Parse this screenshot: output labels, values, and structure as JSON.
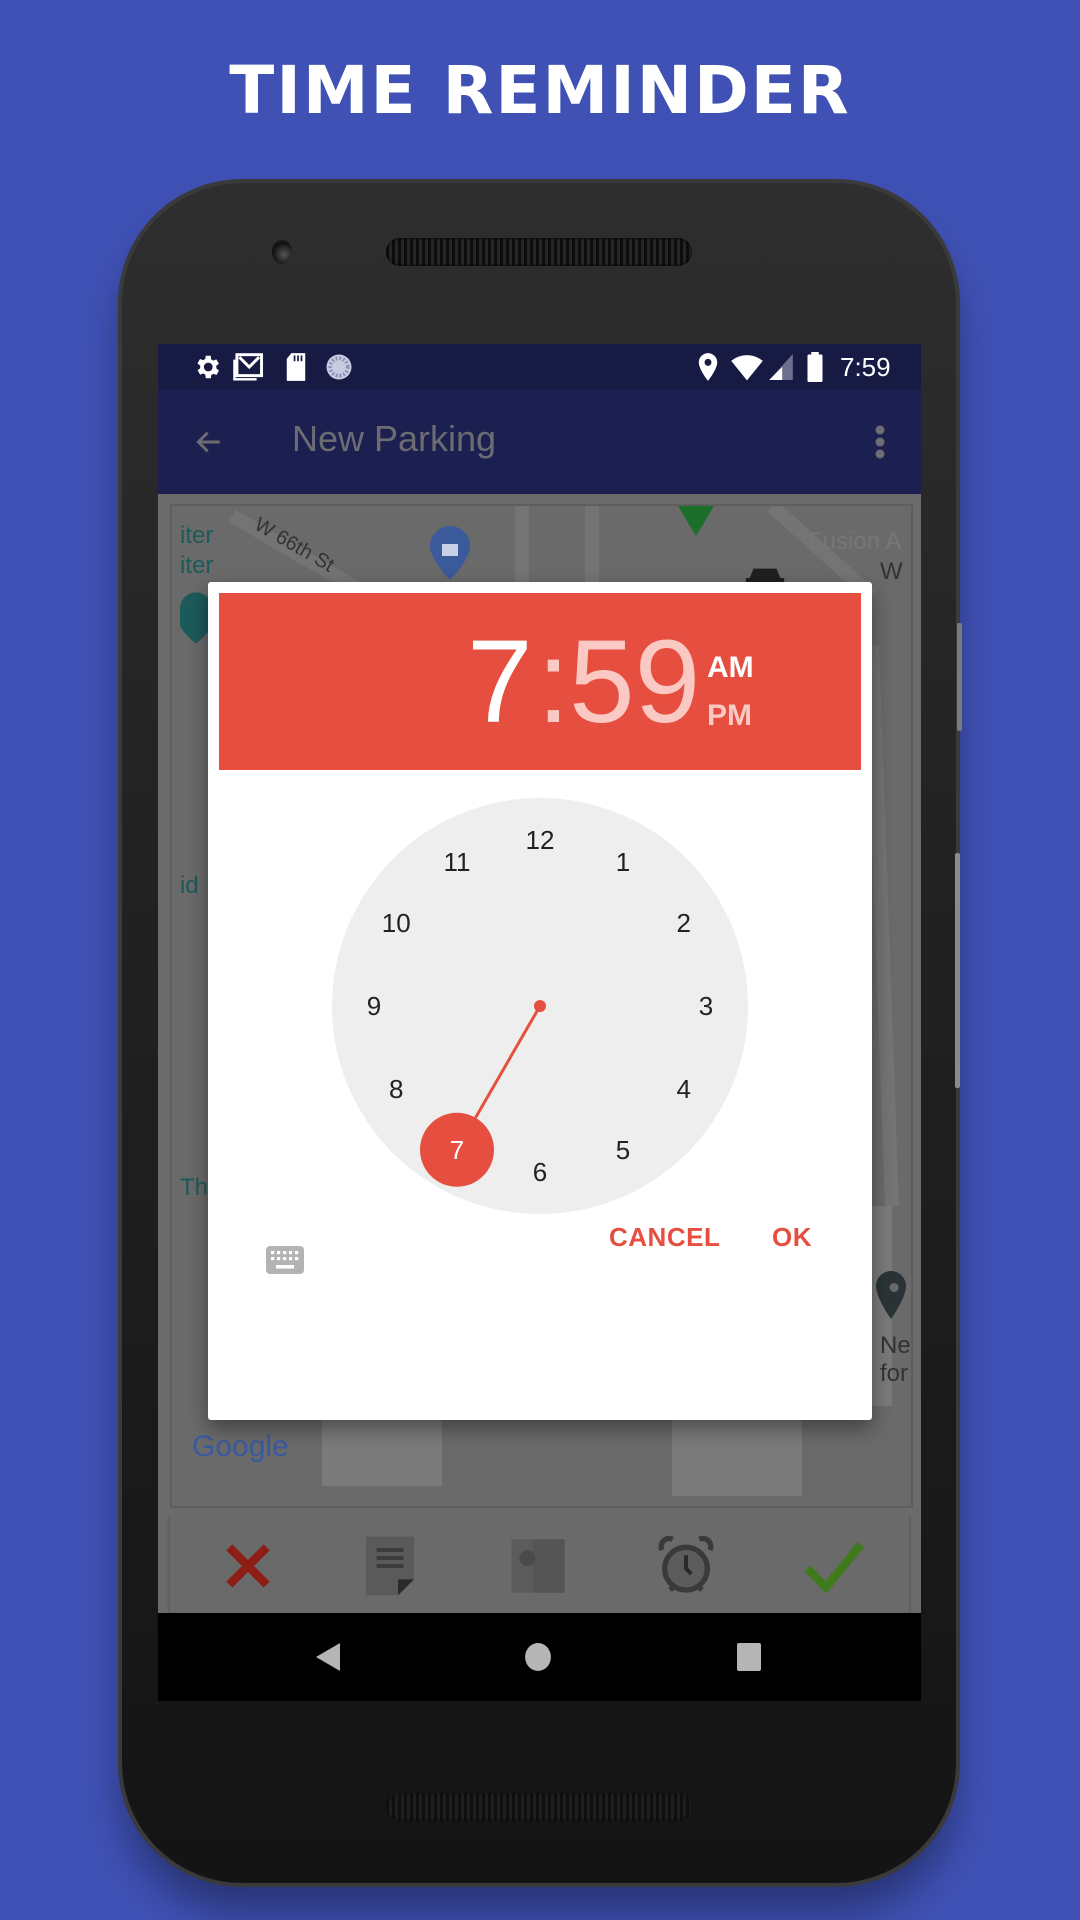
{
  "headline": "TIME REMINDER",
  "status_bar": {
    "left_icons": [
      "settings-icon",
      "gmail-icon",
      "sd-card-icon",
      "sync-icon"
    ],
    "right_icons": [
      "location-icon",
      "wifi-icon",
      "cell-signal-icon",
      "battery-icon"
    ],
    "time": "7:59"
  },
  "app_bar": {
    "back_icon": "arrow-left-icon",
    "title": "New Parking",
    "menu_icon": "more-vert-icon"
  },
  "map": {
    "labels": [
      "iter",
      "iter",
      "W 66th St",
      "id",
      "Th",
      "Fusion A",
      "W",
      "Ne",
      "for"
    ],
    "attribution": "Google"
  },
  "toolbar": {
    "buttons": [
      {
        "name": "cancel",
        "icon": "close-icon",
        "color": "#a8261e"
      },
      {
        "name": "notes",
        "icon": "note-icon"
      },
      {
        "name": "photo",
        "icon": "image-icon"
      },
      {
        "name": "alarm",
        "icon": "alarm-clock-icon"
      },
      {
        "name": "confirm",
        "icon": "check-icon",
        "color": "#3f8a1d"
      }
    ]
  },
  "nav_bar": {
    "buttons": [
      "back-triangle-icon",
      "home-circle-icon",
      "recents-square-icon"
    ]
  },
  "time_picker": {
    "hour": "7",
    "separator": ":",
    "minute": "59",
    "am_label": "AM",
    "pm_label": "PM",
    "selected_period": "AM",
    "mode": "hour",
    "clock_numbers": [
      "12",
      "1",
      "2",
      "3",
      "4",
      "5",
      "6",
      "7",
      "8",
      "9",
      "10",
      "11"
    ],
    "selected_number": "7",
    "keyboard_icon": "keyboard-icon",
    "cancel_label": "CANCEL",
    "ok_label": "OK",
    "accent_color": "#e64f3f"
  }
}
